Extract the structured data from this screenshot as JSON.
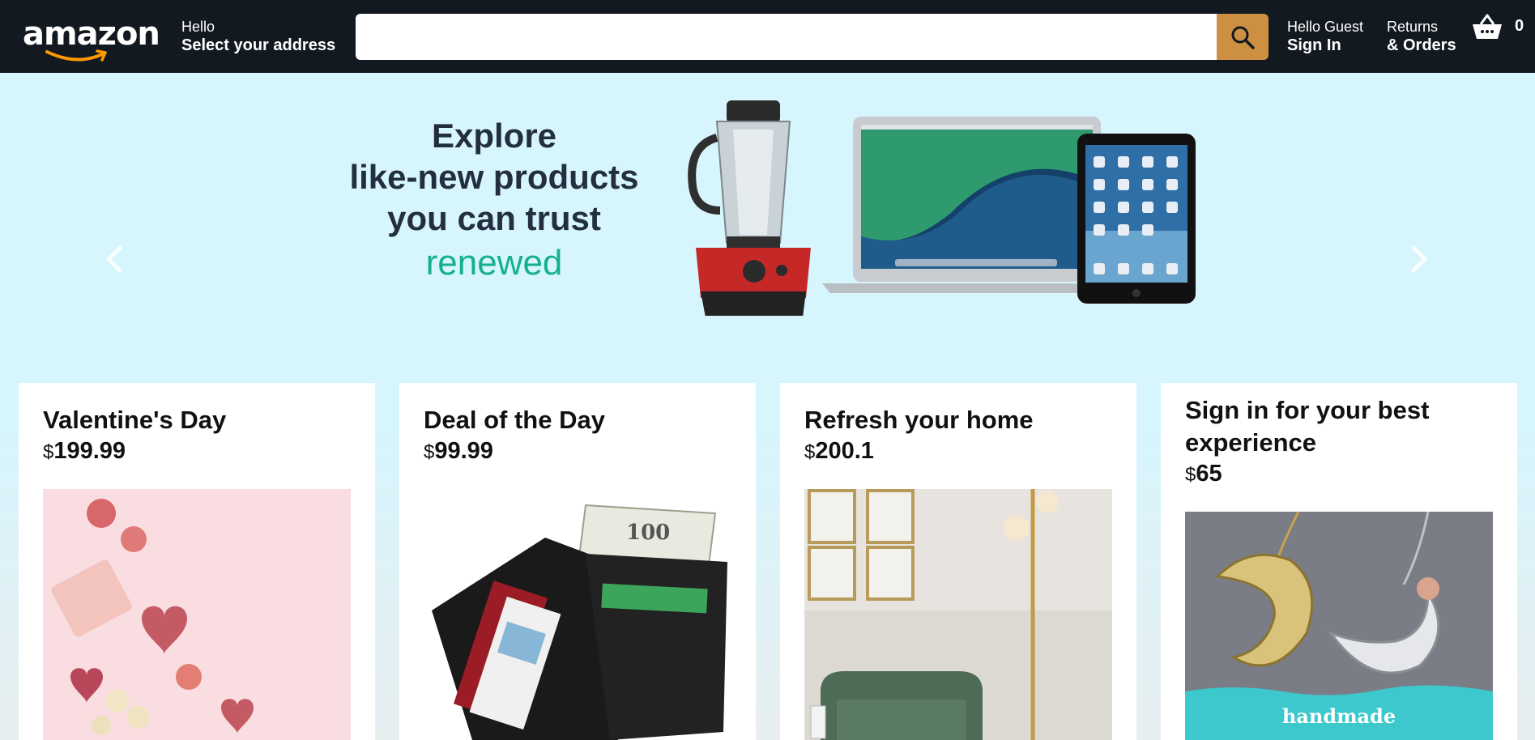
{
  "header": {
    "logo_text": "amazon",
    "address_line1": "Hello",
    "address_line2": "Select your address",
    "search_placeholder": "",
    "account_line1": "Hello Guest",
    "account_line2": "Sign In",
    "orders_line1": "Returns",
    "orders_line2": "& Orders",
    "cart_count": "0"
  },
  "hero": {
    "line1": "Explore",
    "line2": "like-new products",
    "line3": "you can trust",
    "highlight": "renewed",
    "highlight_color": "#16b08f"
  },
  "cards": [
    {
      "title": "Valentine's Day",
      "currency": "$",
      "price": "199.99",
      "image_icon": "valentines-gifts-image"
    },
    {
      "title": "Deal of the Day",
      "currency": "$",
      "price": "99.99",
      "image_icon": "wallet-image"
    },
    {
      "title": "Refresh your home",
      "currency": "$",
      "price": "200.1",
      "image_icon": "living-room-image"
    },
    {
      "title_line1": "Sign in for your best",
      "title_line2": "experience",
      "currency": "$",
      "price": "65",
      "image_icon": "necklace-image",
      "image_caption": "handmade"
    }
  ],
  "colors": {
    "header_bg": "#131921",
    "search_button": "#cd9042",
    "hero_bg": "#d6f5fd",
    "hero_text": "#232f3e"
  }
}
